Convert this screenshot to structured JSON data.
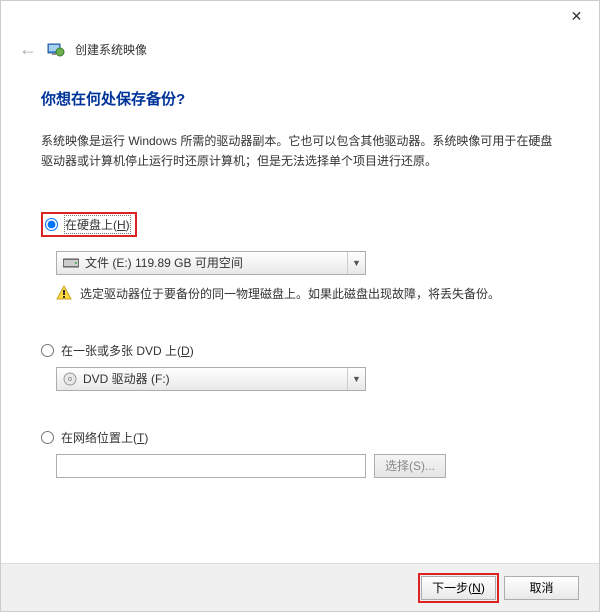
{
  "window": {
    "title": "创建系统映像"
  },
  "main": {
    "heading": "你想在何处保存备份?",
    "description": "系统映像是运行 Windows 所需的驱动器副本。它也可以包含其他驱动器。系统映像可用于在硬盘驱动器或计算机停止运行时还原计算机；但是无法选择单个项目进行还原。"
  },
  "options": {
    "hdd": {
      "label_pre": "在硬盘上(",
      "label_key": "H",
      "label_post": ")",
      "dropdown_value": "文件 (E:)  119.89 GB 可用空间",
      "warning": "选定驱动器位于要备份的同一物理磁盘上。如果此磁盘出现故障，将丢失备份。"
    },
    "dvd": {
      "label_pre": "在一张或多张 DVD 上(",
      "label_key": "D",
      "label_post": ")",
      "dropdown_value": "DVD 驱动器 (F:)"
    },
    "network": {
      "label_pre": "在网络位置上(",
      "label_key": "T",
      "label_post": ")",
      "select_btn_pre": "选择(",
      "select_btn_key": "S",
      "select_btn_post": ")..."
    }
  },
  "footer": {
    "next_pre": "下一步(",
    "next_key": "N",
    "next_post": ")",
    "cancel": "取消"
  }
}
